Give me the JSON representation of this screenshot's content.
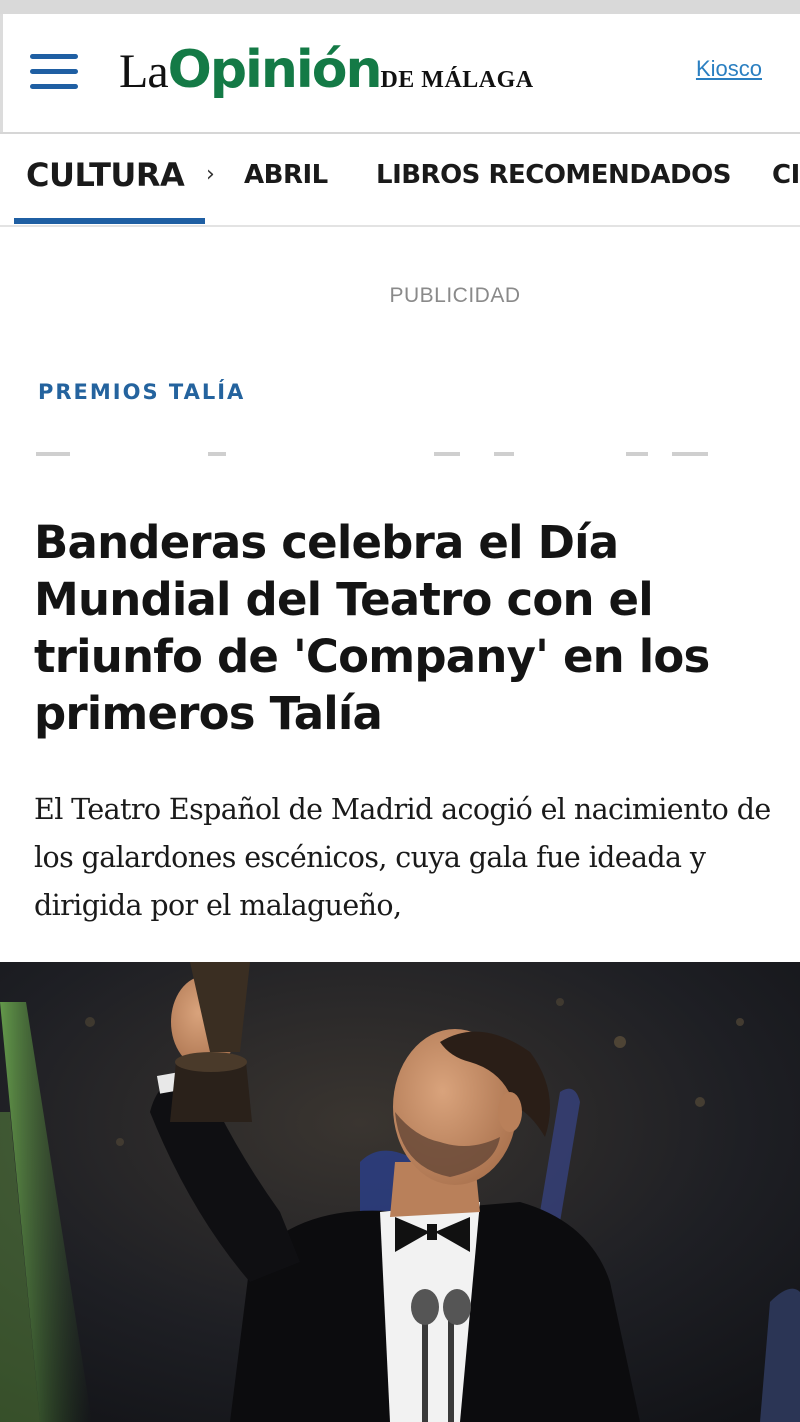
{
  "header": {
    "logo": {
      "la": "La",
      "opinion": "Opinión",
      "de": "DE MÁLAGA"
    },
    "kiosco_label": "Kiosco"
  },
  "subnav": {
    "section": "CULTURA",
    "items": [
      "ABRIL",
      "LIBROS RECOMENDADOS",
      "CI"
    ]
  },
  "ad_label": "PUBLICIDAD",
  "article": {
    "kicker": "PREMIOS TALÍA",
    "headline": "Banderas celebra el Día Mundial del Teatro con el triunfo de 'Company' en los primeros Talía",
    "standfirst": "El Teatro Español de Madrid acogió el nacimiento de los galardones escénicos, cuya gala fue ideada y dirigida por el malagueño,"
  },
  "colors": {
    "brand_green": "#147a46",
    "brand_blue": "#1f5fa3",
    "kicker_blue": "#24639e",
    "link_blue": "#2a7fc1"
  },
  "icons": {
    "menu": "hamburger-menu-icon",
    "chevron": "chevron-right-icon"
  }
}
